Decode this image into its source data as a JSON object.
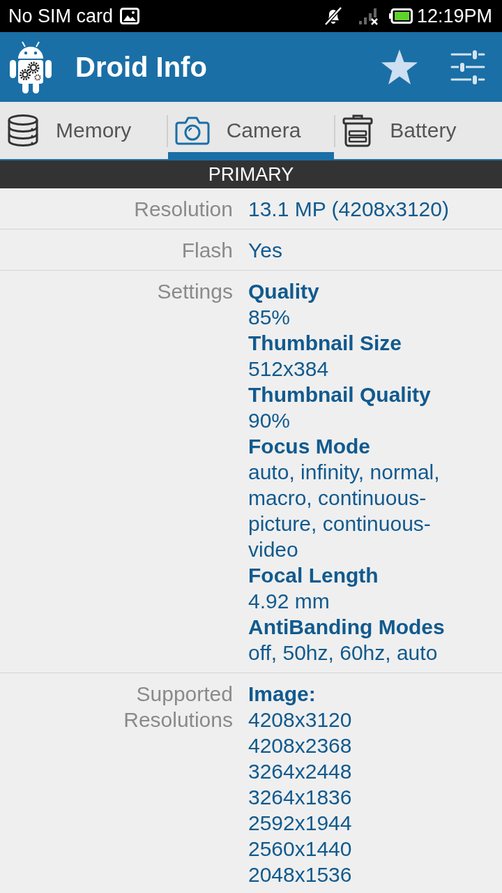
{
  "status_bar": {
    "carrier": "No SIM card",
    "time": "12:19PM"
  },
  "app_bar": {
    "title": "Droid Info"
  },
  "tabs": [
    {
      "label": "Memory",
      "selected": false
    },
    {
      "label": "Camera",
      "selected": true
    },
    {
      "label": "Battery",
      "selected": false
    }
  ],
  "section": {
    "title": "PRIMARY"
  },
  "rows": [
    {
      "kind": "text",
      "label": "Resolution",
      "value": "13.1 MP (4208x3120)"
    },
    {
      "kind": "text",
      "label": "Flash",
      "value": "Yes"
    },
    {
      "kind": "groups",
      "label": "Settings",
      "groups": [
        {
          "heading": "Quality",
          "values": [
            "85%"
          ]
        },
        {
          "heading": "Thumbnail Size",
          "values": [
            "512x384"
          ]
        },
        {
          "heading": "Thumbnail Quality",
          "values": [
            "90%"
          ]
        },
        {
          "heading": "Focus Mode",
          "values": [
            "auto, infinity, normal, macro, continuous-picture, continuous-video"
          ]
        },
        {
          "heading": "Focal Length",
          "values": [
            "4.92 mm"
          ]
        },
        {
          "heading": "AntiBanding Modes",
          "values": [
            "off, 50hz, 60hz, auto"
          ]
        }
      ]
    },
    {
      "kind": "groups",
      "label": "Supported Resolutions",
      "groups": [
        {
          "heading": "Image:",
          "values": [
            "4208x3120",
            "4208x2368",
            "3264x2448",
            "3264x1836",
            "2592x1944",
            "2560x1440",
            "2048x1536"
          ]
        }
      ]
    }
  ]
}
